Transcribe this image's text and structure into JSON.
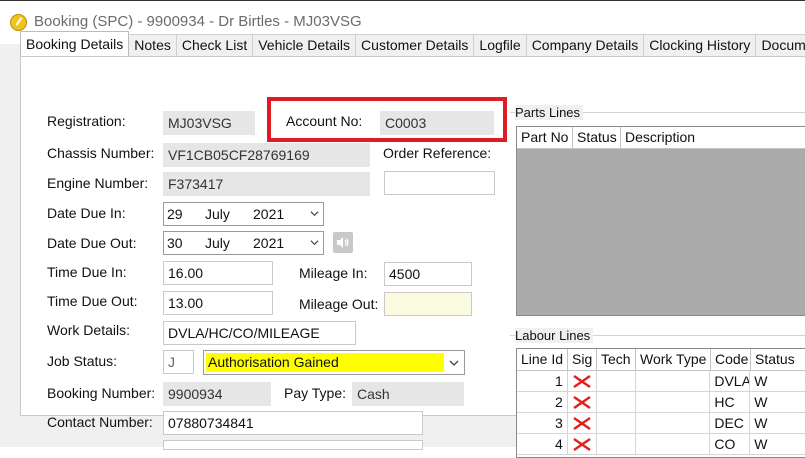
{
  "window": {
    "title": "Booking (SPC) - 9900934 - Dr Birtles - MJ03VSG"
  },
  "tabs": [
    {
      "label": "Booking Details",
      "active": true
    },
    {
      "label": "Notes"
    },
    {
      "label": "Check List"
    },
    {
      "label": "Vehicle Details"
    },
    {
      "label": "Customer Details"
    },
    {
      "label": "Logfile"
    },
    {
      "label": "Company Details"
    },
    {
      "label": "Clocking History"
    },
    {
      "label": "Docume"
    }
  ],
  "form": {
    "registration": {
      "label": "Registration:",
      "value": "MJ03VSG"
    },
    "account_no": {
      "label": "Account No:",
      "value": "C0003"
    },
    "chassis": {
      "label": "Chassis Number:",
      "value": "VF1CB05CF28769169"
    },
    "order_ref": {
      "label": "Order Reference:",
      "value": ""
    },
    "engine": {
      "label": "Engine Number:",
      "value": "F373417"
    },
    "date_due_in": {
      "label": "Date Due In:",
      "day": "29",
      "month": "July",
      "year": "2021"
    },
    "date_due_out": {
      "label": "Date Due Out:",
      "day": "30",
      "month": "July",
      "year": "2021"
    },
    "time_due_in": {
      "label": "Time Due In:",
      "value": "16.00"
    },
    "mileage_in": {
      "label": "Mileage In:",
      "value": "4500"
    },
    "time_due_out": {
      "label": "Time Due Out:",
      "value": "13.00"
    },
    "mileage_out": {
      "label": "Mileage Out:",
      "value": ""
    },
    "work_details": {
      "label": "Work Details:",
      "value": "DVLA/HC/CO/MILEAGE"
    },
    "job_status": {
      "label": "Job Status:",
      "code": "J",
      "value": "Authorisation Gained",
      "highlight": "#ffff00"
    },
    "booking_number": {
      "label": "Booking Number:",
      "value": "9900934"
    },
    "pay_type": {
      "label": "Pay Type:",
      "value": "Cash"
    },
    "contact_number": {
      "label": "Contact Number:",
      "value": "07880734841"
    }
  },
  "parts_lines": {
    "title": "Parts Lines",
    "columns": [
      "Part No",
      "Status",
      "Description"
    ]
  },
  "labour_lines": {
    "title": "Labour Lines",
    "columns": [
      "Line Id",
      "Sig",
      "Tech",
      "Work Type",
      "Code",
      "Status"
    ],
    "rows": [
      {
        "id": "1",
        "sig": "x-icon",
        "tech": "",
        "work_type": "",
        "code": "DVLA",
        "status": "W"
      },
      {
        "id": "2",
        "sig": "x-icon",
        "tech": "",
        "work_type": "",
        "code": "HC",
        "status": "W"
      },
      {
        "id": "3",
        "sig": "x-icon",
        "tech": "",
        "work_type": "",
        "code": "DEC",
        "status": "W"
      },
      {
        "id": "4",
        "sig": "x-icon",
        "tech": "",
        "work_type": "",
        "code": "CO",
        "status": "W"
      }
    ]
  },
  "colors": {
    "highlight_box": "#e01b24",
    "status_yellow": "#ffff00",
    "x_mark": "#e0201c"
  }
}
